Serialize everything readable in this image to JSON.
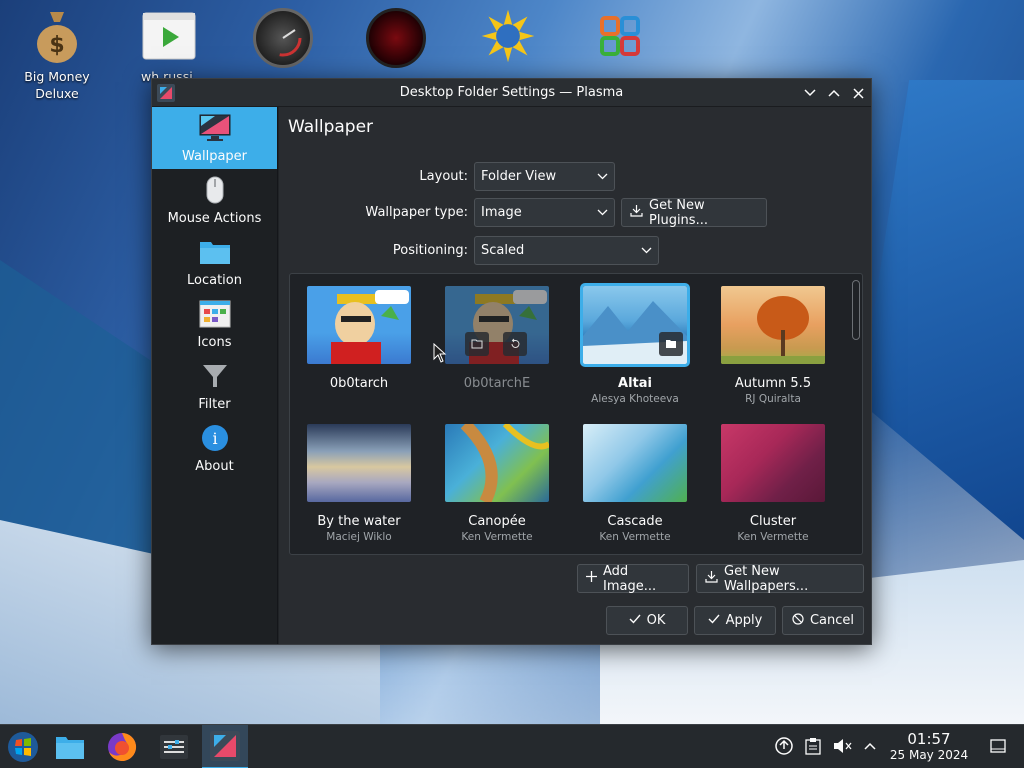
{
  "desktop_icons": [
    {
      "label": "Big Money Deluxe"
    },
    {
      "label": "wh russi"
    }
  ],
  "dialog": {
    "title": "Desktop Folder Settings — Plasma",
    "page_title": "Wallpaper"
  },
  "sidebar": {
    "items": [
      {
        "label": "Wallpaper"
      },
      {
        "label": "Mouse Actions"
      },
      {
        "label": "Location"
      },
      {
        "label": "Icons"
      },
      {
        "label": "Filter"
      },
      {
        "label": "About"
      }
    ]
  },
  "form": {
    "layout_label": "Layout:",
    "layout_value": "Folder View",
    "type_label": "Wallpaper type:",
    "type_value": "Image",
    "get_plugins": "Get New Plugins...",
    "positioning_label": "Positioning:",
    "positioning_value": "Scaled"
  },
  "wallpapers": [
    {
      "name": "0b0tarch",
      "author": ""
    },
    {
      "name": "0b0tarchE",
      "author": ""
    },
    {
      "name": "Altai",
      "author": "Alesya Khoteeva"
    },
    {
      "name": "Autumn 5.5",
      "author": "RJ Quiralta"
    },
    {
      "name": "By the water",
      "author": "Maciej Wiklo"
    },
    {
      "name": "Canopée",
      "author": "Ken Vermette"
    },
    {
      "name": "Cascade",
      "author": "Ken Vermette"
    },
    {
      "name": "Cluster",
      "author": "Ken Vermette"
    }
  ],
  "buttons": {
    "add_image": "Add Image...",
    "get_wallpapers": "Get New Wallpapers...",
    "ok": "OK",
    "apply": "Apply",
    "cancel": "Cancel"
  },
  "clock": {
    "time": "01:57",
    "date": "25 May 2024"
  },
  "colors": {
    "accent": "#3daee9",
    "window_bg": "#292c30",
    "sidebar_bg": "#1d2023"
  }
}
